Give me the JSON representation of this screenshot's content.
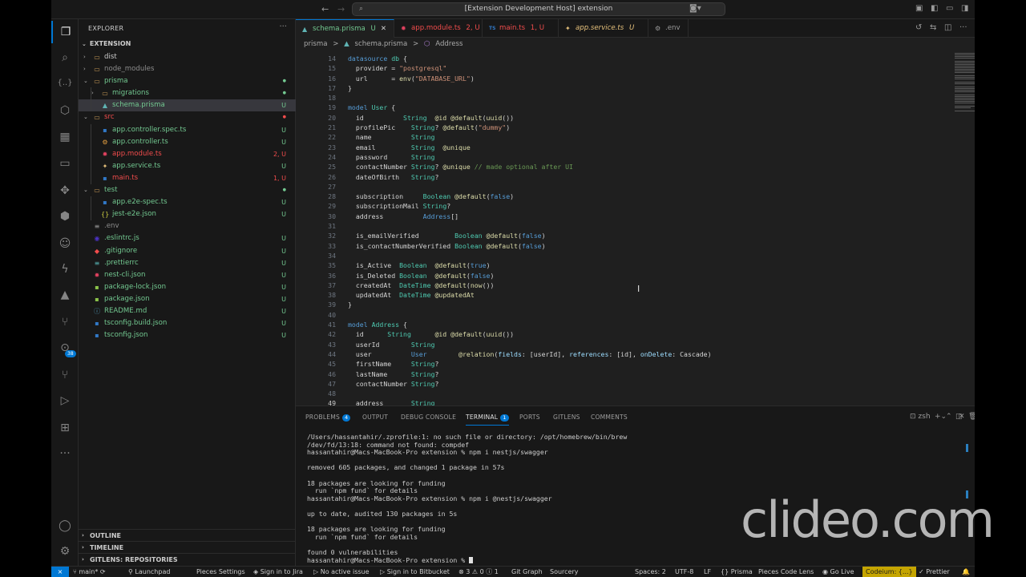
{
  "window": {
    "title": "[Extension Development Host] extension"
  },
  "sidebar": {
    "title": "EXPLORER",
    "root": "EXTENSION",
    "items": [
      {
        "name": "dist",
        "depth": 0,
        "kind": "folder",
        "expanded": false,
        "status": "",
        "color": "#cccccc"
      },
      {
        "name": "node_modules",
        "depth": 0,
        "kind": "folder",
        "expanded": false,
        "status": "",
        "color": "#8c8c8c"
      },
      {
        "name": "prisma",
        "depth": 0,
        "kind": "folder",
        "expanded": true,
        "status": "●",
        "color": "#73c991"
      },
      {
        "name": "migrations",
        "depth": 1,
        "kind": "folder",
        "expanded": false,
        "status": "●",
        "color": "#73c991"
      },
      {
        "name": "schema.prisma",
        "depth": 1,
        "kind": "prisma",
        "expanded": false,
        "status": "U",
        "color": "#73c991",
        "selected": true
      },
      {
        "name": "src",
        "depth": 0,
        "kind": "folder",
        "expanded": true,
        "status": "●",
        "color": "#f14c4c"
      },
      {
        "name": "app.controller.spec.ts",
        "depth": 1,
        "kind": "ts",
        "expanded": false,
        "status": "U",
        "color": "#73c991"
      },
      {
        "name": "app.controller.ts",
        "depth": 1,
        "kind": "gear",
        "expanded": false,
        "status": "U",
        "color": "#73c991"
      },
      {
        "name": "app.module.ts",
        "depth": 1,
        "kind": "module",
        "expanded": false,
        "status": "2, U",
        "color": "#f14c4c"
      },
      {
        "name": "app.service.ts",
        "depth": 1,
        "kind": "service",
        "expanded": false,
        "status": "U",
        "color": "#73c991"
      },
      {
        "name": "main.ts",
        "depth": 1,
        "kind": "ts",
        "expanded": false,
        "status": "1, U",
        "color": "#f14c4c"
      },
      {
        "name": "test",
        "depth": 0,
        "kind": "folder",
        "expanded": true,
        "status": "●",
        "color": "#73c991"
      },
      {
        "name": "app.e2e-spec.ts",
        "depth": 1,
        "kind": "ts",
        "expanded": false,
        "status": "U",
        "color": "#73c991"
      },
      {
        "name": "jest-e2e.json",
        "depth": 1,
        "kind": "json",
        "expanded": false,
        "status": "U",
        "color": "#73c991"
      },
      {
        "name": ".env",
        "depth": 0,
        "kind": "env",
        "expanded": false,
        "status": "",
        "color": "#8c8c8c"
      },
      {
        "name": ".eslintrc.js",
        "depth": 0,
        "kind": "eslint",
        "expanded": false,
        "status": "U",
        "color": "#73c991"
      },
      {
        "name": ".gitignore",
        "depth": 0,
        "kind": "git",
        "expanded": false,
        "status": "U",
        "color": "#73c991"
      },
      {
        "name": ".prettierrc",
        "depth": 0,
        "kind": "prettier",
        "expanded": false,
        "status": "U",
        "color": "#73c991"
      },
      {
        "name": "nest-cli.json",
        "depth": 0,
        "kind": "nest",
        "expanded": false,
        "status": "U",
        "color": "#73c991"
      },
      {
        "name": "package-lock.json",
        "depth": 0,
        "kind": "npm",
        "expanded": false,
        "status": "U",
        "color": "#73c991"
      },
      {
        "name": "package.json",
        "depth": 0,
        "kind": "npm",
        "expanded": false,
        "status": "U",
        "color": "#73c991"
      },
      {
        "name": "README.md",
        "depth": 0,
        "kind": "info",
        "expanded": false,
        "status": "U",
        "color": "#73c991"
      },
      {
        "name": "tsconfig.build.json",
        "depth": 0,
        "kind": "ts",
        "expanded": false,
        "status": "U",
        "color": "#73c991"
      },
      {
        "name": "tsconfig.json",
        "depth": 0,
        "kind": "ts",
        "expanded": false,
        "status": "U",
        "color": "#73c991"
      }
    ],
    "sections": [
      "OUTLINE",
      "TIMELINE",
      "GITLENS: REPOSITORIES"
    ]
  },
  "tabs": [
    {
      "label": "schema.prisma",
      "status": "U",
      "color": "#73c991",
      "icon": "▲",
      "iconColor": "#5fb3b3",
      "active": true,
      "italic": false
    },
    {
      "label": "app.module.ts",
      "status": "2, U",
      "color": "#f14c4c",
      "icon": "✹",
      "iconColor": "#e0415f",
      "active": false,
      "italic": false
    },
    {
      "label": "main.ts",
      "status": "1, U",
      "color": "#f14c4c",
      "icon": "TS",
      "iconColor": "#3178c6",
      "active": false,
      "italic": false
    },
    {
      "label": "app.service.ts",
      "status": "U",
      "color": "#e5c07b",
      "icon": "✦",
      "iconColor": "#e5c07b",
      "active": false,
      "italic": true
    },
    {
      "label": ".env",
      "status": "",
      "color": "#9a9a9a",
      "icon": "⚙",
      "iconColor": "#9a9a9a",
      "active": false,
      "italic": false
    }
  ],
  "breadcrumb": [
    "prisma",
    ">",
    "schema.prisma",
    ">",
    "Address"
  ],
  "code": [
    {
      "n": "14",
      "tokens": [
        [
          "k",
          "datasource "
        ],
        [
          "t",
          "db"
        ],
        [
          "p",
          " {"
        ]
      ]
    },
    {
      "n": "15",
      "tokens": [
        [
          "p",
          "  provider = "
        ],
        [
          "s",
          "\"postgresql\""
        ]
      ]
    },
    {
      "n": "16",
      "tokens": [
        [
          "p",
          "  url      = "
        ],
        [
          "a",
          "env"
        ],
        [
          "p",
          "("
        ],
        [
          "s",
          "\"DATABASE_URL\""
        ],
        [
          "p",
          ")"
        ]
      ]
    },
    {
      "n": "17",
      "tokens": [
        [
          "p",
          "}"
        ]
      ]
    },
    {
      "n": "18",
      "tokens": []
    },
    {
      "n": "19",
      "tokens": [
        [
          "k",
          "model "
        ],
        [
          "t",
          "User"
        ],
        [
          "p",
          " {"
        ]
      ]
    },
    {
      "n": "20",
      "tokens": [
        [
          "p",
          "  id          "
        ],
        [
          "ty",
          "String"
        ],
        [
          "p",
          "  "
        ],
        [
          "a",
          "@id @default"
        ],
        [
          "p",
          "("
        ],
        [
          "a",
          "uuid"
        ],
        [
          "p",
          "())"
        ]
      ]
    },
    {
      "n": "21",
      "tokens": [
        [
          "p",
          "  profilePic    "
        ],
        [
          "ty",
          "String"
        ],
        [
          "p",
          "? "
        ],
        [
          "a",
          "@default"
        ],
        [
          "p",
          "("
        ],
        [
          "s",
          "\"dummy\""
        ],
        [
          "p",
          ")"
        ]
      ]
    },
    {
      "n": "22",
      "tokens": [
        [
          "p",
          "  name          "
        ],
        [
          "ty",
          "String"
        ]
      ]
    },
    {
      "n": "23",
      "tokens": [
        [
          "p",
          "  email         "
        ],
        [
          "ty",
          "String"
        ],
        [
          "p",
          "  "
        ],
        [
          "a",
          "@unique"
        ]
      ]
    },
    {
      "n": "24",
      "tokens": [
        [
          "p",
          "  password      "
        ],
        [
          "ty",
          "String"
        ]
      ]
    },
    {
      "n": "25",
      "tokens": [
        [
          "p",
          "  contactNumber "
        ],
        [
          "ty",
          "String"
        ],
        [
          "p",
          "? "
        ],
        [
          "a",
          "@unique"
        ],
        [
          "c",
          " // made optional after UI"
        ]
      ]
    },
    {
      "n": "26",
      "tokens": [
        [
          "p",
          "  dateOfBirth   "
        ],
        [
          "ty",
          "String"
        ],
        [
          "p",
          "?"
        ]
      ]
    },
    {
      "n": "27",
      "tokens": []
    },
    {
      "n": "28",
      "tokens": [
        [
          "p",
          "  subscription     "
        ],
        [
          "ty",
          "Boolean"
        ],
        [
          "p",
          " "
        ],
        [
          "a",
          "@default"
        ],
        [
          "p",
          "("
        ],
        [
          "kw",
          "false"
        ],
        [
          "p",
          ")"
        ]
      ]
    },
    {
      "n": "29",
      "tokens": [
        [
          "p",
          "  subscriptionMail "
        ],
        [
          "ty",
          "String"
        ],
        [
          "p",
          "?"
        ]
      ]
    },
    {
      "n": "30",
      "tokens": [
        [
          "p",
          "  address          "
        ],
        [
          "k",
          "Address"
        ],
        [
          "p",
          "[]"
        ]
      ]
    },
    {
      "n": "31",
      "tokens": []
    },
    {
      "n": "32",
      "tokens": [
        [
          "p",
          "  is_emailVerified         "
        ],
        [
          "ty",
          "Boolean"
        ],
        [
          "p",
          " "
        ],
        [
          "a",
          "@default"
        ],
        [
          "p",
          "("
        ],
        [
          "kw",
          "false"
        ],
        [
          "p",
          ")"
        ]
      ]
    },
    {
      "n": "33",
      "tokens": [
        [
          "p",
          "  is_contactNumberVerified "
        ],
        [
          "ty",
          "Boolean"
        ],
        [
          "p",
          " "
        ],
        [
          "a",
          "@default"
        ],
        [
          "p",
          "("
        ],
        [
          "kw",
          "false"
        ],
        [
          "p",
          ")"
        ]
      ]
    },
    {
      "n": "34",
      "tokens": []
    },
    {
      "n": "35",
      "tokens": [
        [
          "p",
          "  is_Active  "
        ],
        [
          "ty",
          "Boolean"
        ],
        [
          "p",
          "  "
        ],
        [
          "a",
          "@default"
        ],
        [
          "p",
          "("
        ],
        [
          "kw",
          "true"
        ],
        [
          "p",
          ")"
        ]
      ]
    },
    {
      "n": "36",
      "tokens": [
        [
          "p",
          "  is_Deleted "
        ],
        [
          "ty",
          "Boolean"
        ],
        [
          "p",
          "  "
        ],
        [
          "a",
          "@default"
        ],
        [
          "p",
          "("
        ],
        [
          "kw",
          "false"
        ],
        [
          "p",
          ")"
        ]
      ]
    },
    {
      "n": "37",
      "tokens": [
        [
          "p",
          "  createdAt  "
        ],
        [
          "ty",
          "DateTime"
        ],
        [
          "p",
          " "
        ],
        [
          "a",
          "@default"
        ],
        [
          "p",
          "("
        ],
        [
          "a",
          "now"
        ],
        [
          "p",
          "())"
        ]
      ]
    },
    {
      "n": "38",
      "tokens": [
        [
          "p",
          "  updatedAt  "
        ],
        [
          "ty",
          "DateTime"
        ],
        [
          "p",
          " "
        ],
        [
          "a",
          "@updatedAt"
        ]
      ]
    },
    {
      "n": "39",
      "tokens": [
        [
          "p",
          "}"
        ]
      ]
    },
    {
      "n": "40",
      "tokens": []
    },
    {
      "n": "41",
      "tokens": [
        [
          "k",
          "model "
        ],
        [
          "t",
          "Address"
        ],
        [
          "p",
          " {"
        ]
      ]
    },
    {
      "n": "42",
      "tokens": [
        [
          "p",
          "  id      "
        ],
        [
          "ty",
          "String"
        ],
        [
          "p",
          "      "
        ],
        [
          "a",
          "@id @default"
        ],
        [
          "p",
          "("
        ],
        [
          "a",
          "uuid"
        ],
        [
          "p",
          "())"
        ]
      ]
    },
    {
      "n": "43",
      "tokens": [
        [
          "p",
          "  userId        "
        ],
        [
          "ty",
          "String"
        ]
      ]
    },
    {
      "n": "44",
      "tokens": [
        [
          "p",
          "  user          "
        ],
        [
          "k",
          "User"
        ],
        [
          "p",
          "        "
        ],
        [
          "a",
          "@relation"
        ],
        [
          "p",
          "("
        ],
        [
          "v",
          "fields"
        ],
        [
          "p",
          ": [userId], "
        ],
        [
          "v",
          "references"
        ],
        [
          "p",
          ": [id], "
        ],
        [
          "v",
          "onDelete"
        ],
        [
          "p",
          ": Cascade)"
        ]
      ]
    },
    {
      "n": "45",
      "tokens": [
        [
          "p",
          "  firstName     "
        ],
        [
          "ty",
          "String"
        ],
        [
          "p",
          "?"
        ]
      ]
    },
    {
      "n": "46",
      "tokens": [
        [
          "p",
          "  lastName      "
        ],
        [
          "ty",
          "String"
        ],
        [
          "p",
          "?"
        ]
      ]
    },
    {
      "n": "47",
      "tokens": [
        [
          "p",
          "  contactNumber "
        ],
        [
          "ty",
          "String"
        ],
        [
          "p",
          "?"
        ]
      ]
    },
    {
      "n": "48",
      "tokens": []
    },
    {
      "n": "49",
      "tokens": [
        [
          "p",
          "  address       "
        ],
        [
          "ty",
          "String"
        ]
      ],
      "current": true
    }
  ],
  "panel": {
    "tabs": [
      {
        "label": "PROBLEMS",
        "badge": "4",
        "active": false
      },
      {
        "label": "OUTPUT",
        "badge": "",
        "active": false
      },
      {
        "label": "DEBUG CONSOLE",
        "badge": "",
        "active": false
      },
      {
        "label": "TERMINAL",
        "badge": "1",
        "active": true
      },
      {
        "label": "PORTS",
        "badge": "",
        "active": false
      },
      {
        "label": "GITLENS",
        "badge": "",
        "active": false
      },
      {
        "label": "COMMENTS",
        "badge": "",
        "active": false
      }
    ],
    "shell": "zsh",
    "terminal": [
      "/Users/hassantahir/.zprofile:1: no such file or directory: /opt/homebrew/bin/brew",
      "/dev/fd/13:18: command not found: compdef",
      "hassantahir@Macs-MacBook-Pro extension % npm i nestjs/swagger",
      "",
      "removed 605 packages, and changed 1 package in 57s",
      "",
      "18 packages are looking for funding",
      "  run `npm fund` for details",
      "hassantahir@Macs-MacBook-Pro extension % npm i @nestjs/swagger",
      "",
      "up to date, audited 130 packages in 5s",
      "",
      "18 packages are looking for funding",
      "  run `npm fund` for details",
      "",
      "found 0 vulnerabilities",
      "hassantahir@Macs-MacBook-Pro extension % "
    ]
  },
  "statusbar": {
    "branch": "main*",
    "launchpad": "Launchpad",
    "pieces_settings": "Pieces Settings",
    "sign_in_jira": "Sign in to Jira",
    "no_active_issue": "No active issue",
    "sign_in_bitbucket": "Sign in to Bitbucket",
    "errors": "3",
    "warnings": "0",
    "info": "1",
    "git_graph": "Git Graph",
    "sourcery": "Sourcery",
    "spaces": "Spaces: 2",
    "encoding": "UTF-8",
    "eol": "LF",
    "language": "Prisma",
    "pieces_lens": "Pieces Code Lens",
    "go_live": "Go Live",
    "codeium": "Codeium: {...}",
    "prettier": "Prettier"
  },
  "activity_badge": "38",
  "watermark": "clideo.com"
}
